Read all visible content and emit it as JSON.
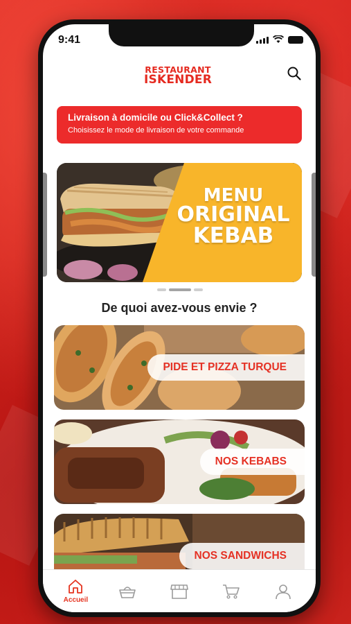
{
  "status_bar": {
    "time": "9:41"
  },
  "header": {
    "logo_line1": "RESTAURANT",
    "logo_line2": "ISKENDER"
  },
  "delivery_banner": {
    "title": "Livraison à domicile ou Click&Collect ?",
    "subtitle": "Choisissez le mode de livraison de votre commande"
  },
  "promo": {
    "line1": "MENU",
    "line2": "ORIGINAL",
    "line3": "KEBAB"
  },
  "section_title": "De quoi avez-vous envie ?",
  "categories": [
    {
      "label": "PIDE ET PIZZA TURQUE"
    },
    {
      "label": "NOS KEBABS"
    },
    {
      "label": "NOS SANDWICHS"
    }
  ],
  "tabbar": {
    "home_label": "Accueil"
  },
  "colors": {
    "brand_red": "#e52a20",
    "accent_yellow": "#f8b52a",
    "icon_gray": "#9a9a9a"
  }
}
